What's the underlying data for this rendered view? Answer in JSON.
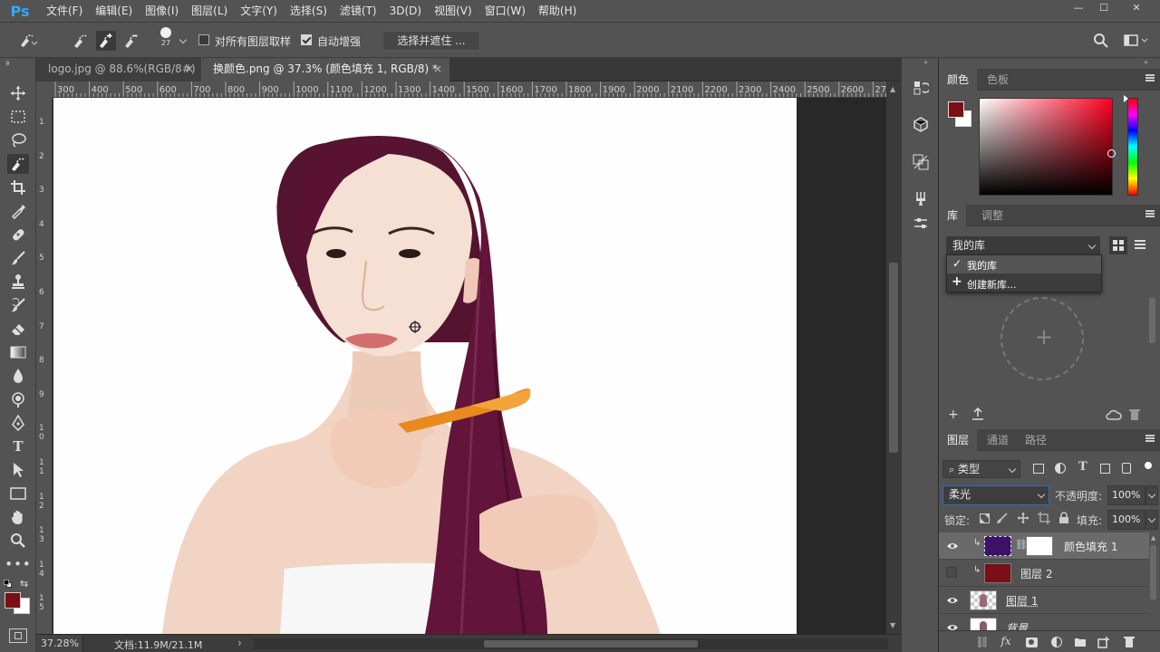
{
  "app": {
    "logo": "Ps"
  },
  "menu": [
    "文件(F)",
    "编辑(E)",
    "图像(I)",
    "图层(L)",
    "文字(Y)",
    "选择(S)",
    "滤镜(T)",
    "3D(D)",
    "视图(V)",
    "窗口(W)",
    "帮助(H)"
  ],
  "options": {
    "brush_size": "27",
    "sample_all_layers": "对所有图层取样",
    "sample_all_checked": false,
    "auto_enhance": "自动增强",
    "auto_enhance_checked": true,
    "select_and_mask": "选择并遮住 ..."
  },
  "tabs": [
    {
      "label": "logo.jpg @ 88.6%(RGB/8#)",
      "close": "×",
      "active": false
    },
    {
      "label": "换颜色.png @ 37.3% (颜色填充 1, RGB/8) *",
      "close": "×",
      "active": true
    }
  ],
  "ruler": {
    "h": [
      "300",
      "400",
      "500",
      "600",
      "700",
      "800",
      "900",
      "1000",
      "1100",
      "1200",
      "1300",
      "1400",
      "1500",
      "1600",
      "1700",
      "1800",
      "1900",
      "2000",
      "2100",
      "2200",
      "2300",
      "2400",
      "2500",
      "2600",
      "2700"
    ],
    "v": [
      "1",
      "2",
      "3",
      "4",
      "5",
      "6",
      "7",
      "8",
      "9",
      "1 0",
      "1 1",
      "1 2",
      "1 3",
      "1 4",
      "1 5"
    ]
  },
  "status": {
    "zoom": "37.28%",
    "doc": "文档:11.9M/21.1M",
    "arrow": "›"
  },
  "color_panel": {
    "tabs": [
      "颜色",
      "色板"
    ],
    "fg_color": "#7a0f17",
    "bg_color": "#ffffff",
    "hue_color": "#ff0020"
  },
  "library_panel": {
    "tabs": [
      "库",
      "调整"
    ],
    "selected": "我的库",
    "menu_items": [
      "我的库",
      "创建新库..."
    ],
    "menu_icons": [
      "✓",
      "+"
    ],
    "add": "+"
  },
  "layers_panel": {
    "tabs": [
      "图层",
      "通道",
      "路径"
    ],
    "filter": "类型",
    "blend_mode": "柔光",
    "opacity_label": "不透明度:",
    "opacity": "100%",
    "lock_label": "锁定:",
    "fill_label": "填充:",
    "fill": "100%",
    "layers": [
      {
        "name": "颜色填充 1",
        "visible": true,
        "selected": true,
        "thumb_color": "#3d1266",
        "mask": true,
        "clipped": true
      },
      {
        "name": "图层 2",
        "visible": false,
        "selected": false,
        "thumb_color": "#7a0f17",
        "mask": false,
        "clipped": true
      },
      {
        "name": "图层 1",
        "visible": true,
        "selected": false,
        "thumb_color": "checker",
        "mask": false,
        "clipped": false
      },
      {
        "name": "背景",
        "visible": true,
        "selected": false,
        "thumb_color": "#ffffff",
        "mask": false,
        "clipped": false
      }
    ]
  }
}
